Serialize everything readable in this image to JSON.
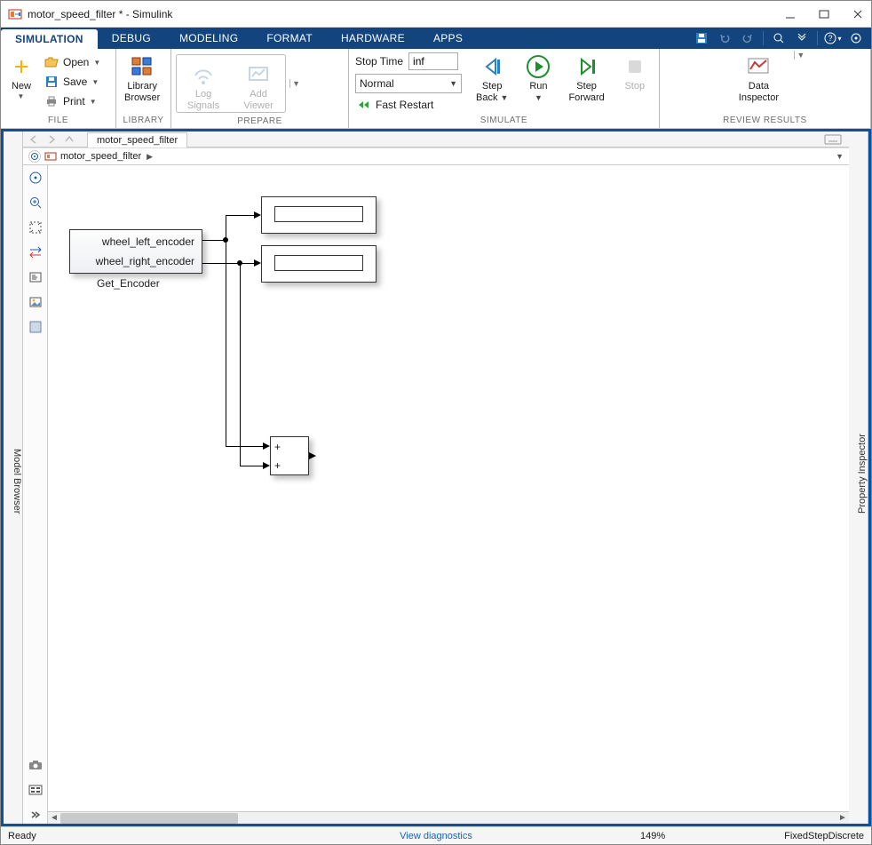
{
  "window": {
    "title": "motor_speed_filter * - Simulink"
  },
  "tabs": [
    "SIMULATION",
    "DEBUG",
    "MODELING",
    "FORMAT",
    "HARDWARE",
    "APPS"
  ],
  "active_tab": 0,
  "toolstrip": {
    "file": {
      "new": "New",
      "open": "Open",
      "save": "Save",
      "print": "Print",
      "group": "FILE"
    },
    "library": {
      "line1": "Library",
      "line2": "Browser",
      "group": "LIBRARY"
    },
    "prepare": {
      "log1": "Log",
      "log2": "Signals",
      "add1": "Add",
      "add2": "Viewer",
      "group": "PREPARE"
    },
    "sim": {
      "stoptime_label": "Stop Time",
      "stoptime_value": "inf",
      "mode": "Normal",
      "fast": "Fast Restart",
      "stepback": "Step",
      "stepback2": "Back",
      "run": "Run",
      "stepfwd": "Step",
      "stepfwd2": "Forward",
      "stop": "Stop",
      "group": "SIMULATE"
    },
    "review": {
      "line1": "Data",
      "line2": "Inspector",
      "group": "REVIEW RESULTS"
    }
  },
  "model_browser": "Model Browser",
  "property_inspector": "Property Inspector",
  "doc": {
    "tab": "motor_speed_filter",
    "crumb": "motor_speed_filter"
  },
  "blocks": {
    "encoder_out1": "wheel_left_encoder",
    "encoder_out2": "wheel_right_encoder",
    "encoder_name": "Get_Encoder",
    "sum_ops": [
      "+",
      "+"
    ]
  },
  "status": {
    "ready": "Ready",
    "diag": "View diagnostics",
    "zoom": "149%",
    "solver": "FixedStepDiscrete"
  }
}
